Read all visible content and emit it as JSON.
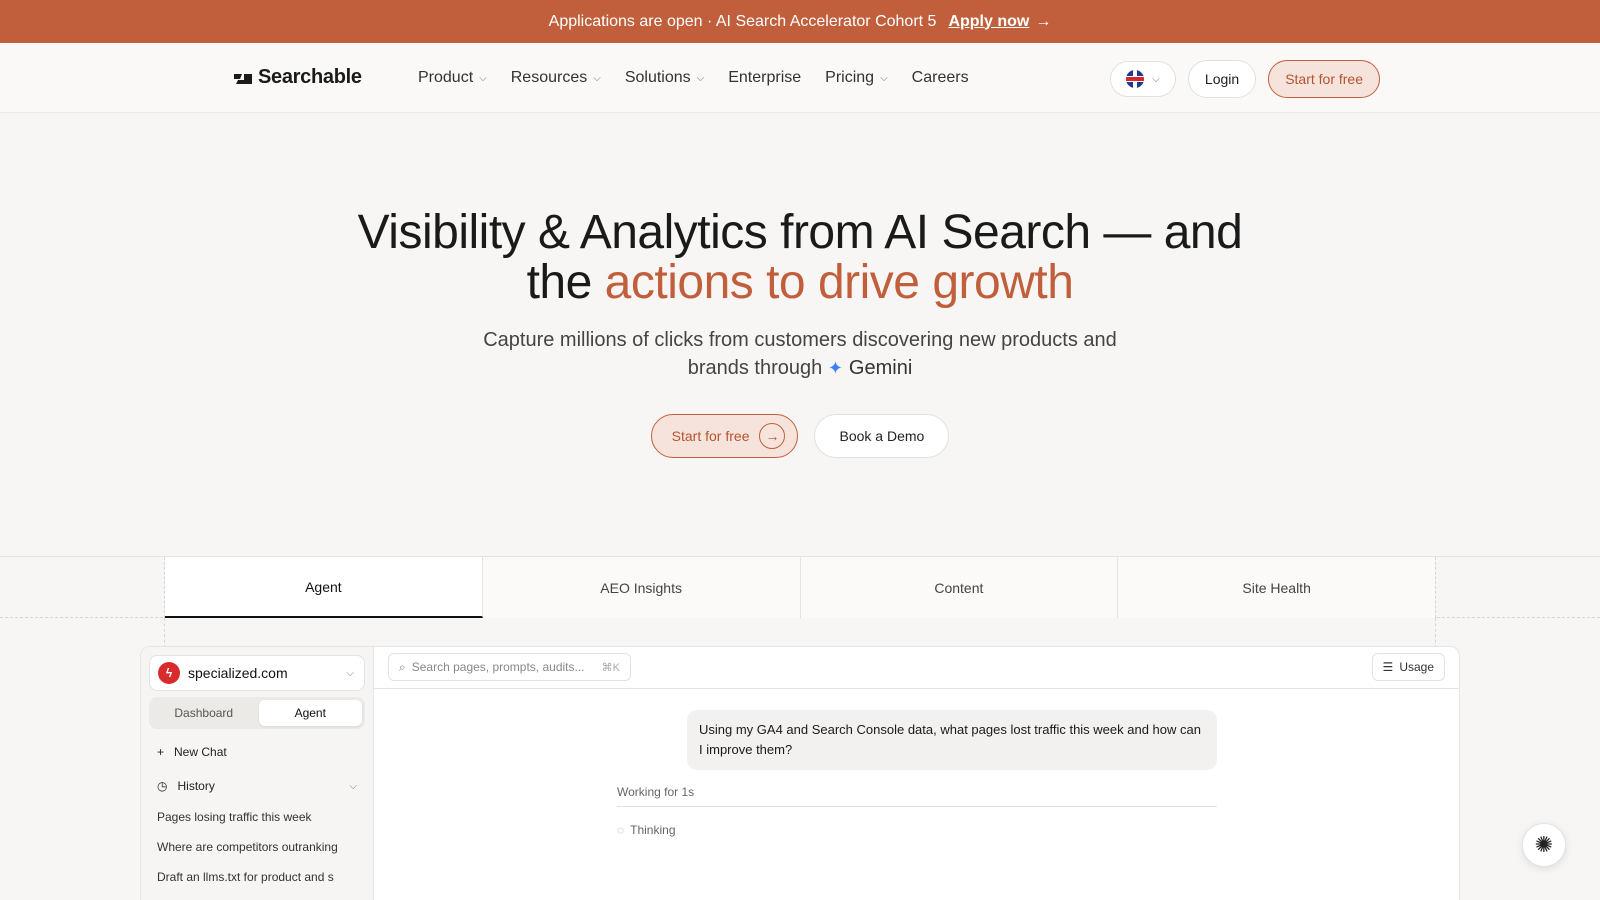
{
  "banner": {
    "text": "Applications are open · AI Search Accelerator Cohort 5",
    "cta": "Apply now",
    "cta_arrow": "→",
    "bg": "#c15f3c"
  },
  "nav": {
    "brand": "Searchable",
    "items": [
      {
        "label": "Product",
        "dropdown": true
      },
      {
        "label": "Resources",
        "dropdown": true
      },
      {
        "label": "Solutions",
        "dropdown": true
      },
      {
        "label": "Enterprise",
        "dropdown": false
      },
      {
        "label": "Pricing",
        "dropdown": true
      },
      {
        "label": "Careers",
        "dropdown": false
      }
    ],
    "language_icon": "uk-flag-icon",
    "login": "Login",
    "start": "Start for free"
  },
  "hero": {
    "title_part1": "Visibility & Analytics from AI Search — and",
    "title_part2": "the",
    "title_accent": "actions to drive growth",
    "subtitle_line1": "Capture millions of clicks from customers discovering new products and",
    "subtitle_line2": "brands through",
    "engine": "Gemini",
    "primary_cta": "Start for free",
    "secondary_cta": "Book a Demo",
    "accent": "#c15f3c"
  },
  "tabs": [
    {
      "label": "Agent",
      "active": true
    },
    {
      "label": "AEO Insights",
      "active": false
    },
    {
      "label": "Content",
      "active": false
    },
    {
      "label": "Site Health",
      "active": false
    }
  ],
  "app": {
    "site": "specialized.com",
    "switch": [
      "Dashboard",
      "Agent"
    ],
    "new_chat": "New Chat",
    "history_label": "History",
    "history": [
      "Pages losing traffic this week",
      "Where are competitors outranking",
      "Draft an llms.txt for product and s"
    ],
    "search_placeholder": "Search pages, prompts, audits...",
    "search_kbd": "⌘K",
    "usage": "Usage",
    "message": "Using my GA4 and Search Console data, what pages lost traffic this week and how can I improve them?",
    "working": "Working for 1s",
    "thinking": "Thinking"
  }
}
